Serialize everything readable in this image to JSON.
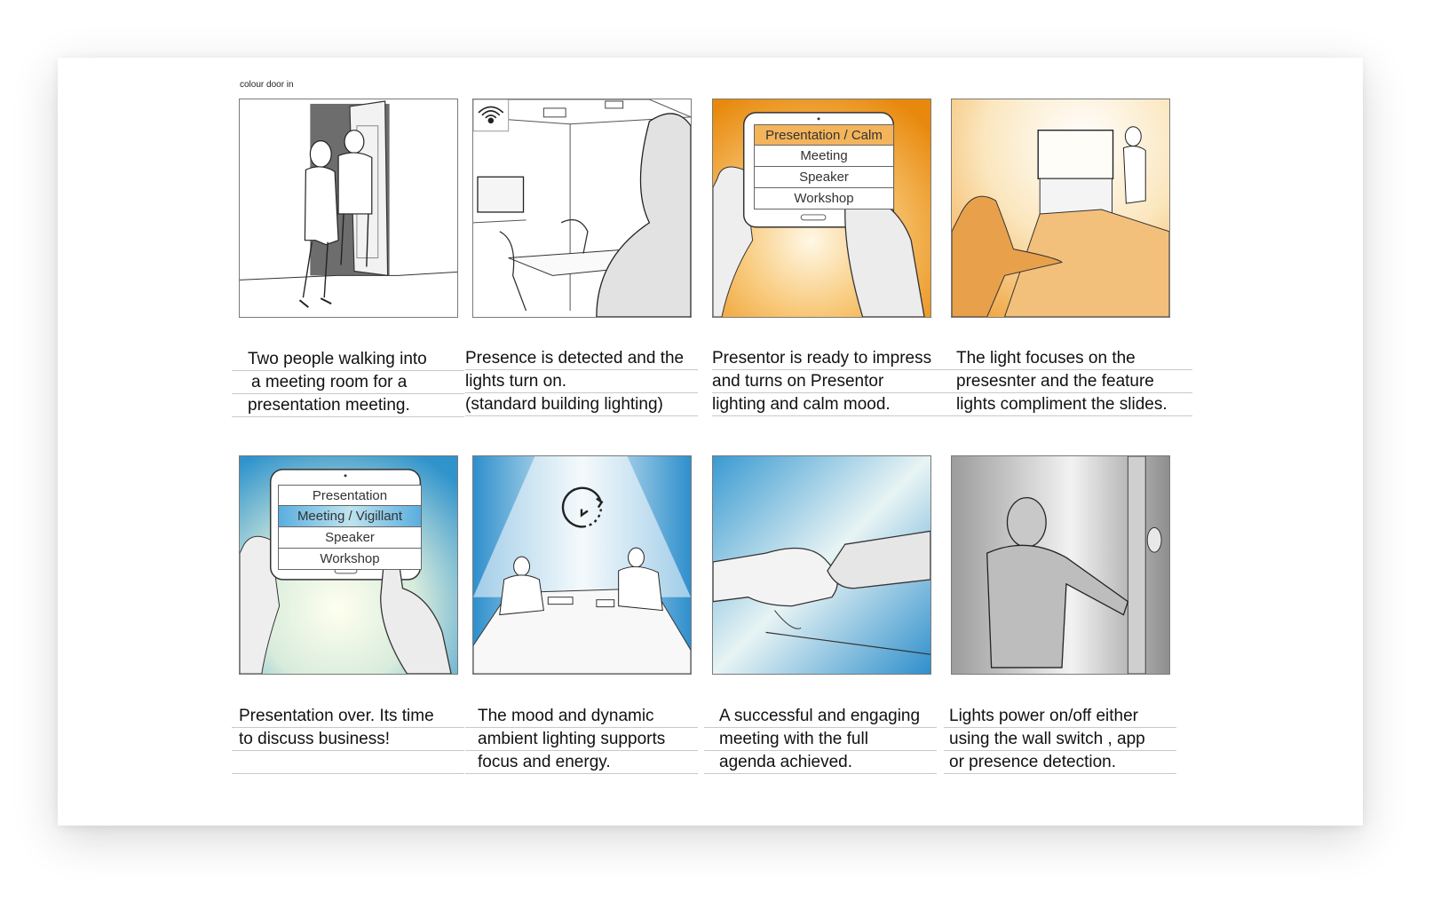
{
  "note": "colour door in",
  "panels": [
    {
      "alt": "two people walking into room",
      "caption": [
        "Two people walking into",
        "a meeting room for a",
        "presentation meeting."
      ],
      "indent": [
        14,
        18,
        14
      ]
    },
    {
      "alt": "lights turn on",
      "caption": [
        "Presence is detected and the",
        "lights turn on.",
        "(standard building lighting)"
      ],
      "indent": [
        0,
        0,
        0
      ]
    },
    {
      "alt": "tablet presentation mode",
      "menu": [
        "Presentation / Calm",
        "Meeting",
        "Speaker",
        "Workshop"
      ],
      "caption": [
        "Presentor is ready to impress",
        "and turns on Presentor",
        "lighting and calm mood."
      ],
      "indent": [
        0,
        0,
        0
      ]
    },
    {
      "alt": "presenter at screen",
      "caption": [
        "The light focuses on the",
        "presesnter and the feature",
        "lights compliment the slides."
      ],
      "indent": [
        14,
        14,
        14
      ]
    },
    {
      "alt": "tablet meeting mode",
      "menu": [
        "Presentation",
        "Meeting / Vigillant",
        "Speaker",
        "Workshop"
      ],
      "caption": [
        "Presentation over. Its time",
        "to discuss business!",
        ""
      ],
      "indent": [
        8,
        8,
        8
      ]
    },
    {
      "alt": "two people at table",
      "caption": [
        "The mood and dynamic",
        "ambient lighting supports",
        "focus and energy."
      ],
      "indent": [
        14,
        14,
        14
      ]
    },
    {
      "alt": "handshake",
      "caption": [
        "A successful and engaging",
        "meeting with the full",
        "agenda achieved."
      ],
      "indent": [
        17,
        17,
        17
      ]
    },
    {
      "alt": "person at wall switch",
      "caption": [
        "Lights power on/off either",
        "using the wall switch , app",
        "or presence detection."
      ],
      "indent": [
        6,
        6,
        6
      ]
    }
  ]
}
